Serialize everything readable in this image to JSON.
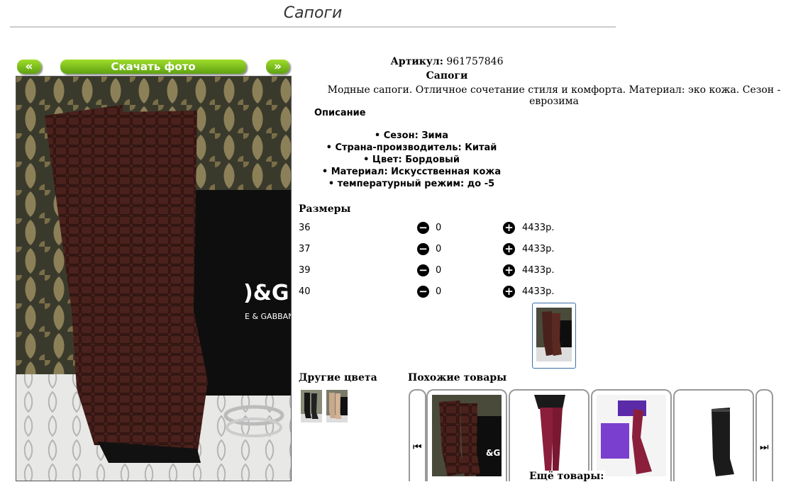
{
  "page": {
    "title": "Сапоги"
  },
  "gallery": {
    "prev": "«",
    "download": "Скачать фото",
    "next": "»"
  },
  "product": {
    "article_label": "Артикул:",
    "article_value": "961757846",
    "name": "Сапоги",
    "summary": "Модные сапоги. Отличное сочетание стиля и комфорта. Материал: эко кожа. Сезон - еврозима"
  },
  "description": {
    "heading": "Описание",
    "items": [
      "Сезон: Зима",
      "Страна-производитель: Китай",
      "Цвет: Бордовый",
      "Материал: Искусственная кожа",
      "температурный режим: до -5"
    ]
  },
  "sizes": {
    "heading": "Размеры",
    "rows": [
      {
        "size": "36",
        "qty": "0",
        "price": "4433р."
      },
      {
        "size": "37",
        "qty": "0",
        "price": "4433р."
      },
      {
        "size": "39",
        "qty": "0",
        "price": "4433р."
      },
      {
        "size": "40",
        "qty": "0",
        "price": "4433р."
      }
    ]
  },
  "other_colors": {
    "heading": "Другие цвета"
  },
  "similar": {
    "heading": "Похожие товары",
    "more": "Ещё товары:"
  },
  "colors": {
    "button_green": "#6fb31a",
    "boot_brown": "#4a211c",
    "burgundy": "#8b1f3b",
    "selected_border": "#3a6fa8"
  }
}
